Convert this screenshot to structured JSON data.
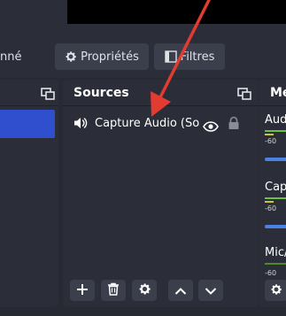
{
  "toolbar": {
    "selected_suffix": "nné",
    "properties_label": "Propriétés",
    "filters_label": "Filtres"
  },
  "sources": {
    "title": "Sources",
    "items": [
      {
        "label": "Capture Audio (Sortie)",
        "visible_icon": "eye-icon",
        "lock_icon": "lock-icon"
      }
    ],
    "controls": [
      {
        "name": "add-source-button",
        "icon": "plus-icon"
      },
      {
        "name": "remove-source-button",
        "icon": "trash-icon"
      },
      {
        "name": "source-properties-button",
        "icon": "gear-icon"
      },
      {
        "name": "move-source-up-button",
        "icon": "chevron-up-icon"
      },
      {
        "name": "move-source-down-button",
        "icon": "chevron-down-icon"
      }
    ]
  },
  "mixer": {
    "title": "Mé",
    "channels": [
      {
        "label": "Aud",
        "tick": "-60"
      },
      {
        "label": "Capt",
        "tick": "-60"
      },
      {
        "label": "Mic/",
        "tick": "-60"
      }
    ]
  },
  "colors": {
    "accent": "#2f4fce",
    "arrow": "#e23b32",
    "meter_green": "#6fbf40",
    "meter_yellow": "#c7c73a",
    "slider": "#4a82e6"
  }
}
